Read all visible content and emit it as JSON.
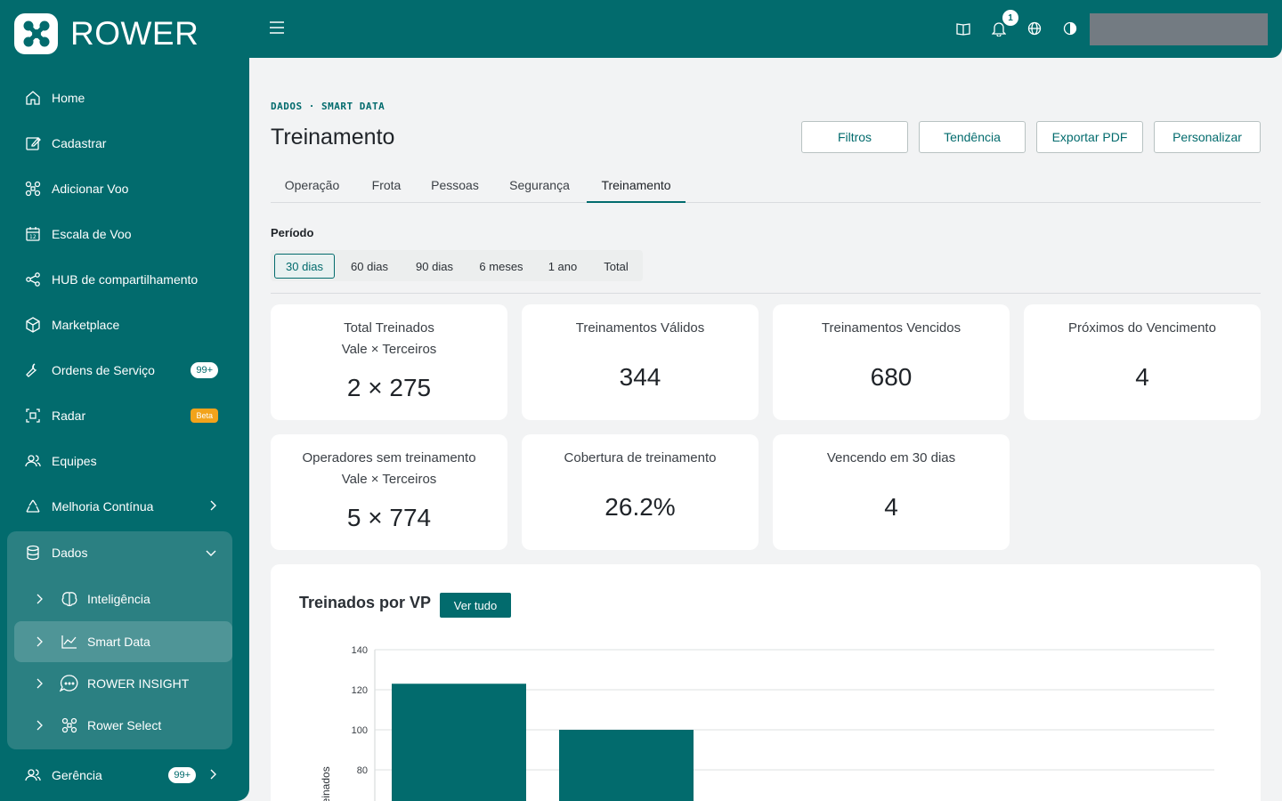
{
  "brand": {
    "name": "ROWER"
  },
  "sidebar": {
    "items": [
      {
        "label": "Home",
        "icon": "home-icon"
      },
      {
        "label": "Cadastrar",
        "icon": "edit-icon"
      },
      {
        "label": "Adicionar Voo",
        "icon": "drone-icon"
      },
      {
        "label": "Escala de Voo",
        "icon": "calendar-icon"
      },
      {
        "label": "HUB de compartilhamento",
        "icon": "share-icon"
      },
      {
        "label": "Marketplace",
        "icon": "box-icon"
      },
      {
        "label": "Ordens de Serviço",
        "icon": "wrench-icon",
        "badge": "99+"
      },
      {
        "label": "Radar",
        "icon": "radar-icon",
        "badge": "Beta"
      },
      {
        "label": "Equipes",
        "icon": "team-icon"
      },
      {
        "label": "Melhoria Contínua",
        "icon": "recycle-icon"
      }
    ],
    "dados": {
      "label": "Dados",
      "children": [
        {
          "label": "Inteligência",
          "icon": "brain-icon"
        },
        {
          "label": "Smart Data",
          "icon": "chart-line-icon"
        },
        {
          "label": "ROWER INSIGHT",
          "icon": "chat-icon"
        },
        {
          "label": "Rower Select",
          "icon": "drone-icon"
        }
      ]
    },
    "gerencia": {
      "label": "Gerência",
      "badge": "99+"
    }
  },
  "header": {
    "notifications": "1"
  },
  "breadcrumb": "DADOS · SMART DATA",
  "page_title": "Treinamento",
  "actions": {
    "filtros": "Filtros",
    "tendencia": "Tendência",
    "exportar": "Exportar PDF",
    "personalizar": "Personalizar"
  },
  "tabs": [
    "Operação",
    "Frota",
    "Pessoas",
    "Segurança",
    "Treinamento"
  ],
  "periodo": {
    "label": "Período",
    "options": [
      "30 dias",
      "60 dias",
      "90 dias",
      "6 meses",
      "1 ano",
      "Total"
    ],
    "selected": "30 dias"
  },
  "cards": [
    {
      "label": "Total Treinados",
      "sub": "Vale × Terceiros",
      "value": "2 × 275"
    },
    {
      "label": "Treinamentos Válidos",
      "value": "344"
    },
    {
      "label": "Treinamentos Vencidos",
      "value": "680"
    },
    {
      "label": "Próximos do Vencimento",
      "value": "4"
    },
    {
      "label": "Operadores sem treinamento",
      "sub": "Vale × Terceiros",
      "value": "5 × 774"
    },
    {
      "label": "Cobertura de treinamento",
      "value": "26.2%"
    },
    {
      "label": "Vencendo em 30 dias",
      "value": "4"
    }
  ],
  "chart_section": {
    "title": "Treinados por VP",
    "button": "Ver tudo"
  },
  "chart_data": {
    "type": "bar",
    "ylabel": "res Treinados",
    "yticks": [
      80,
      100,
      120,
      140
    ],
    "ylim": [
      0,
      140
    ],
    "values": [
      123,
      100
    ],
    "bar_color": "#026b6d",
    "grid": true
  }
}
